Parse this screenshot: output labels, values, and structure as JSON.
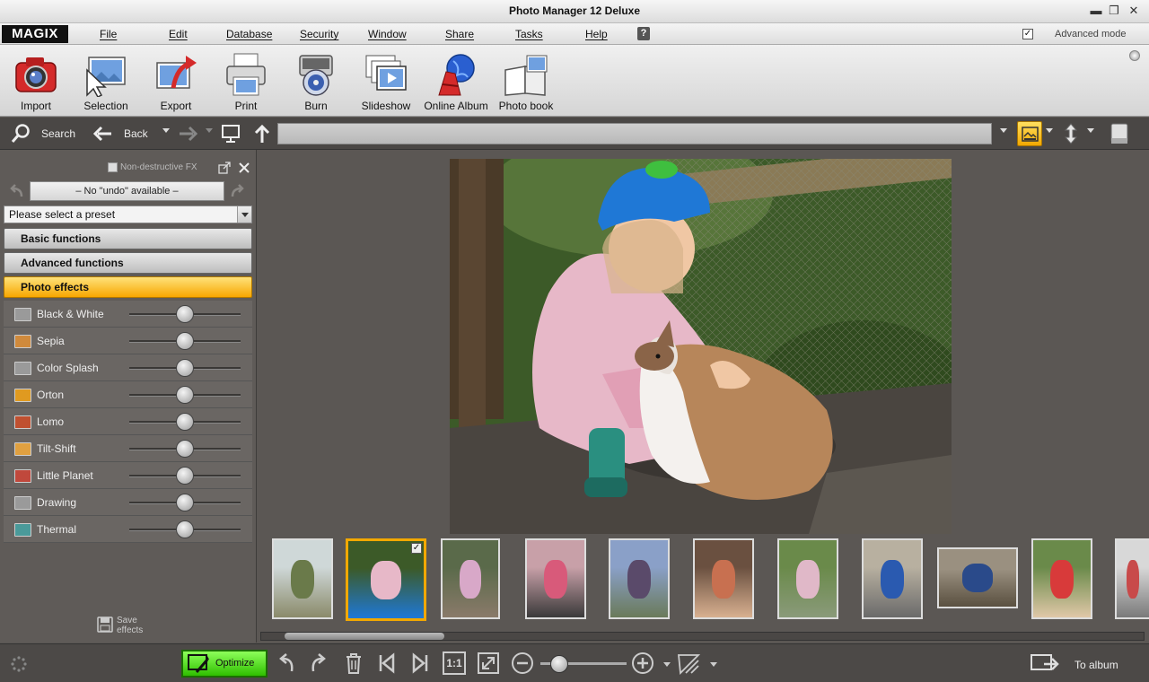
{
  "window": {
    "title": "Photo Manager 12 Deluxe",
    "controls": [
      "minimize",
      "restore",
      "close"
    ]
  },
  "menubar": {
    "logo": "MAGIX",
    "items": [
      "File",
      "Edit",
      "Database",
      "Security",
      "Window",
      "Share",
      "Tasks",
      "Help"
    ],
    "advanced_mode_label": "Advanced mode",
    "advanced_mode_checked": "✓"
  },
  "toolbar": {
    "items": [
      {
        "label": "Import",
        "icon": "camera-icon"
      },
      {
        "label": "Selection",
        "icon": "selection-icon"
      },
      {
        "label": "Export",
        "icon": "export-icon"
      },
      {
        "label": "Print",
        "icon": "printer-icon"
      },
      {
        "label": "Burn",
        "icon": "disc-icon"
      },
      {
        "label": "Slideshow",
        "icon": "slideshow-icon"
      },
      {
        "label": "Online Album",
        "icon": "globe-icon"
      },
      {
        "label": "Photo book",
        "icon": "photobook-icon"
      }
    ]
  },
  "navbar": {
    "search_label": "Search",
    "back_label": "Back"
  },
  "left_panel": {
    "non_destructive_label": "Non-destructive FX",
    "undo_text": "– No \"undo\" available –",
    "preset_placeholder": "Please select a preset",
    "sections": [
      "Basic functions",
      "Advanced functions",
      "Photo effects"
    ],
    "active_section": "Photo effects",
    "effects": [
      {
        "label": "Black & White",
        "color": "#9a9a9a",
        "value": 50
      },
      {
        "label": "Sepia",
        "color": "#d08a3c",
        "value": 50
      },
      {
        "label": "Color Splash",
        "color": "#9a9a9a",
        "value": 50
      },
      {
        "label": "Orton",
        "color": "#e09a20",
        "value": 50
      },
      {
        "label": "Lomo",
        "color": "#c05030",
        "value": 50
      },
      {
        "label": "Tilt-Shift",
        "color": "#e0a040",
        "value": 50
      },
      {
        "label": "Little Planet",
        "color": "#c0483c",
        "value": 50
      },
      {
        "label": "Drawing",
        "color": "#9a9a9a",
        "value": 50
      },
      {
        "label": "Thermal",
        "color": "#4a9a9a",
        "value": 50
      }
    ],
    "save_effects_label": "Save effects"
  },
  "filmstrip": {
    "count": 11,
    "selected_index": 1
  },
  "bottombar": {
    "optimize_label": "Optimize",
    "to_album_label": "To album",
    "ratio_label": "1:1"
  },
  "colors": {
    "accent": "#f2a800",
    "optimize": "#3ccf00",
    "background": "#5b5754"
  }
}
